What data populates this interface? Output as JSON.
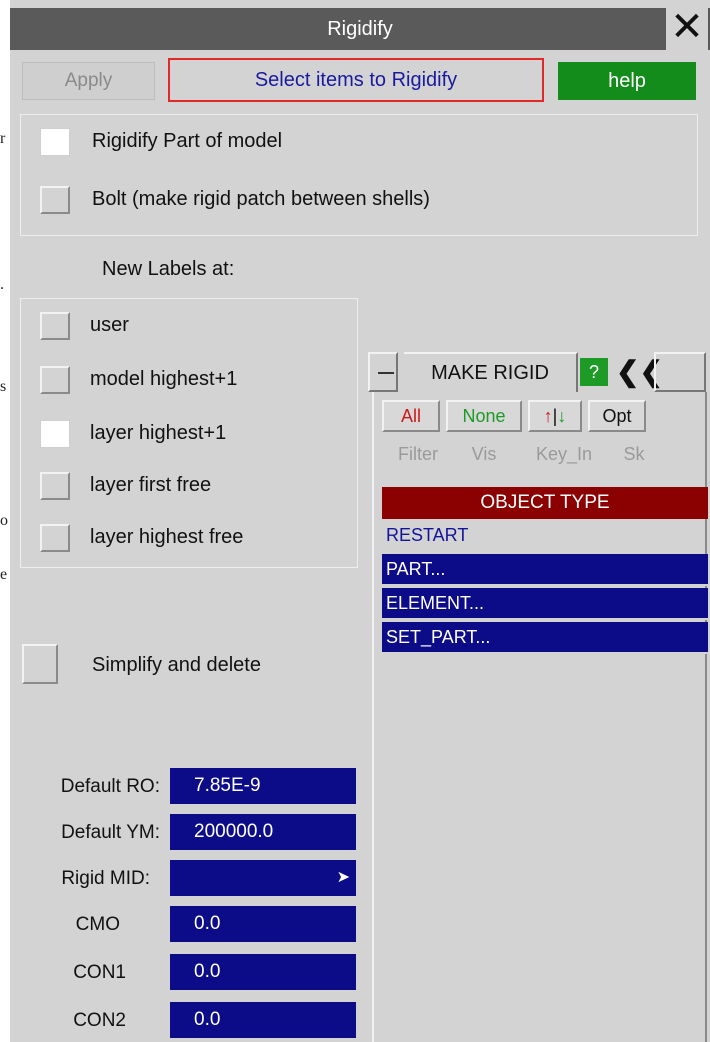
{
  "dialog": {
    "title": "Rigidify",
    "close_glyph": "✕",
    "apply_label": "Apply",
    "select_label": "Select items to Rigidify",
    "help_label": "help"
  },
  "options": {
    "rigidify_part": {
      "label": "Rigidify Part of model",
      "checked": true
    },
    "bolt": {
      "label": "Bolt (make rigid patch between shells)",
      "checked": false
    }
  },
  "new_labels": {
    "heading": "New Labels at:",
    "items": [
      {
        "label": "user",
        "checked": false
      },
      {
        "label": "model highest+1",
        "checked": false
      },
      {
        "label": "layer highest+1",
        "checked": true
      },
      {
        "label": "layer first free",
        "checked": false
      },
      {
        "label": "layer highest free",
        "checked": false
      }
    ]
  },
  "simplify": {
    "label": "Simplify and delete",
    "checked": false
  },
  "fields": [
    {
      "label": "Default RO:",
      "value": "7.85E-9"
    },
    {
      "label": "Default YM:",
      "value": "200000.0"
    },
    {
      "label": "Rigid MID:",
      "value": ""
    },
    {
      "label": "CMO",
      "value": "0.0"
    },
    {
      "label": "CON1",
      "value": "0.0"
    },
    {
      "label": "CON2",
      "value": "0.0"
    }
  ],
  "make_rigid": {
    "title": "MAKE RIGID",
    "help_q": "?",
    "chevron": "❮❮",
    "buttons_row1": [
      "All",
      "None",
      "",
      "Opt"
    ],
    "buttons_row2": [
      "Filter",
      "Vis",
      "Key_In",
      "Sk"
    ],
    "object_type_header": "OBJECT TYPE",
    "objects": [
      {
        "label": "RESTART",
        "selected": false
      },
      {
        "label": "PART...",
        "selected": true
      },
      {
        "label": "ELEMENT...",
        "selected": true
      },
      {
        "label": "SET_PART...",
        "selected": true
      }
    ]
  },
  "colors": {
    "title_bar": "#5a5a5a",
    "help_green": "#148c1c",
    "field_blue": "#0c0c88",
    "object_header_red": "#8b0000",
    "select_border_red": "#e02a2a"
  },
  "stray_glyphs": [
    "r",
    ".",
    "s",
    "o",
    "e"
  ]
}
